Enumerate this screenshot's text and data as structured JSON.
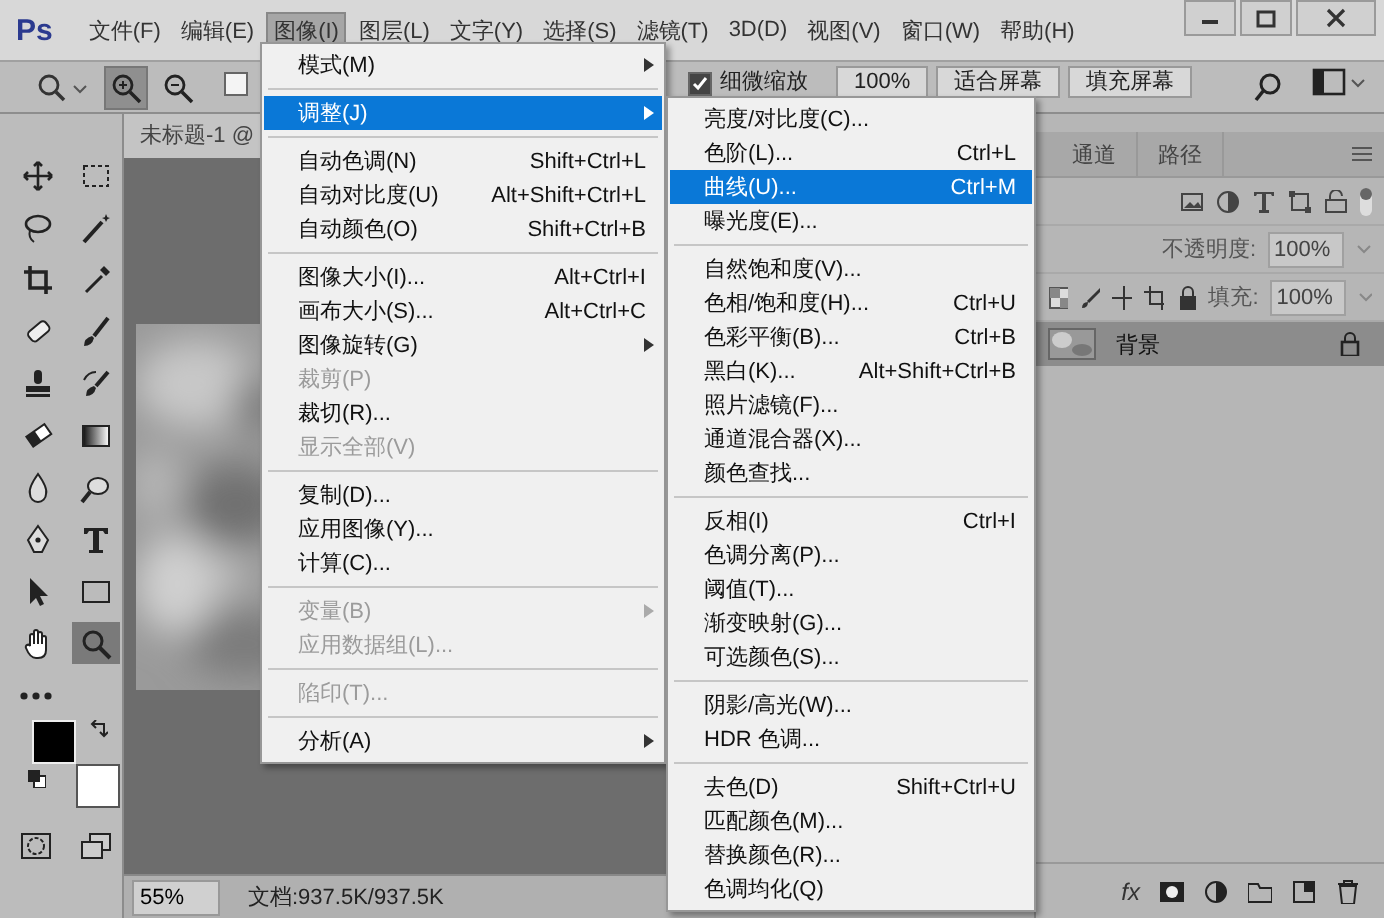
{
  "menubar": {
    "logo": "Ps",
    "items": [
      {
        "label": "文件(F)",
        "selected": false
      },
      {
        "label": "编辑(E)",
        "selected": false
      },
      {
        "label": "图像(I)",
        "selected": true
      },
      {
        "label": "图层(L)",
        "selected": false
      },
      {
        "label": "文字(Y)",
        "selected": false
      },
      {
        "label": "选择(S)",
        "selected": false
      },
      {
        "label": "滤镜(T)",
        "selected": false
      },
      {
        "label": "3D(D)",
        "selected": false
      },
      {
        "label": "视图(V)",
        "selected": false
      },
      {
        "label": "窗口(W)",
        "selected": false
      },
      {
        "label": "帮助(H)",
        "selected": false
      }
    ]
  },
  "options_bar": {
    "zoom_modes": [
      {
        "selected": true
      },
      {
        "selected": false
      }
    ],
    "resize_checkbox": {
      "checked": false
    },
    "scrubby_zoom": {
      "label": "细微缩放",
      "checked": true
    },
    "buttons": [
      "100%",
      "适合屏幕",
      "填充屏幕"
    ]
  },
  "toolbox": {
    "tools": [
      {
        "selected": false
      },
      {
        "selected": false
      },
      {
        "selected": false
      },
      {
        "selected": false
      },
      {
        "selected": false
      },
      {
        "selected": false
      },
      {
        "selected": false
      },
      {
        "selected": false
      },
      {
        "selected": false
      },
      {
        "selected": false
      },
      {
        "selected": false
      },
      {
        "selected": false
      },
      {
        "selected": false
      },
      {
        "selected": false
      },
      {
        "selected": false
      },
      {
        "selected": false
      },
      {
        "selected": false
      },
      {
        "selected": false
      },
      {
        "selected": false
      },
      {
        "selected": true
      }
    ]
  },
  "document": {
    "tab": "未标题-1 @",
    "zoom": "55%",
    "info": "文档:937.5K/937.5K"
  },
  "layers_panel": {
    "tabs": [
      {
        "label": "通道",
        "selected": false
      },
      {
        "label": "路径",
        "selected": false
      }
    ],
    "opacity_label": "不透明度:",
    "opacity": "100%",
    "fill_label": "填充:",
    "fill": "100%",
    "layers": [
      {
        "name": "背景",
        "selected": true,
        "locked": true
      }
    ],
    "footer_text": "fx"
  },
  "image_menu": {
    "groups": [
      [
        {
          "label": "模式(M)",
          "submenu": true,
          "disabled": false,
          "selected": false
        }
      ],
      [
        {
          "label": "调整(J)",
          "submenu": true,
          "disabled": false,
          "selected": true
        }
      ],
      [
        {
          "label": "自动色调(N)",
          "shortcut": "Shift+Ctrl+L",
          "submenu": false,
          "disabled": false,
          "selected": false
        },
        {
          "label": "自动对比度(U)",
          "shortcut": "Alt+Shift+Ctrl+L",
          "submenu": false,
          "disabled": false,
          "selected": false
        },
        {
          "label": "自动颜色(O)",
          "shortcut": "Shift+Ctrl+B",
          "submenu": false,
          "disabled": false,
          "selected": false
        }
      ],
      [
        {
          "label": "图像大小(I)...",
          "shortcut": "Alt+Ctrl+I",
          "submenu": false,
          "disabled": false,
          "selected": false
        },
        {
          "label": "画布大小(S)...",
          "shortcut": "Alt+Ctrl+C",
          "submenu": false,
          "disabled": false,
          "selected": false
        },
        {
          "label": "图像旋转(G)",
          "submenu": true,
          "disabled": false,
          "selected": false
        },
        {
          "label": "裁剪(P)",
          "submenu": false,
          "disabled": true,
          "selected": false
        },
        {
          "label": "裁切(R)...",
          "submenu": false,
          "disabled": false,
          "selected": false
        },
        {
          "label": "显示全部(V)",
          "submenu": false,
          "disabled": true,
          "selected": false
        }
      ],
      [
        {
          "label": "复制(D)...",
          "submenu": false,
          "disabled": false,
          "selected": false
        },
        {
          "label": "应用图像(Y)...",
          "submenu": false,
          "disabled": false,
          "selected": false
        },
        {
          "label": "计算(C)...",
          "submenu": false,
          "disabled": false,
          "selected": false
        }
      ],
      [
        {
          "label": "变量(B)",
          "submenu": true,
          "disabled": true,
          "selected": false
        },
        {
          "label": "应用数据组(L)...",
          "submenu": false,
          "disabled": true,
          "selected": false
        }
      ],
      [
        {
          "label": "陷印(T)...",
          "submenu": false,
          "disabled": true,
          "selected": false
        }
      ],
      [
        {
          "label": "分析(A)",
          "submenu": true,
          "disabled": false,
          "selected": false
        }
      ]
    ]
  },
  "adjust_submenu": {
    "groups": [
      [
        {
          "label": "亮度/对比度(C)...",
          "disabled": false,
          "selected": false
        },
        {
          "label": "色阶(L)...",
          "shortcut": "Ctrl+L",
          "disabled": false,
          "selected": false
        },
        {
          "label": "曲线(U)...",
          "shortcut": "Ctrl+M",
          "disabled": false,
          "selected": true
        },
        {
          "label": "曝光度(E)...",
          "disabled": false,
          "selected": false
        }
      ],
      [
        {
          "label": "自然饱和度(V)...",
          "disabled": false,
          "selected": false
        },
        {
          "label": "色相/饱和度(H)...",
          "shortcut": "Ctrl+U",
          "disabled": false,
          "selected": false
        },
        {
          "label": "色彩平衡(B)...",
          "shortcut": "Ctrl+B",
          "disabled": false,
          "selected": false
        },
        {
          "label": "黑白(K)...",
          "shortcut": "Alt+Shift+Ctrl+B",
          "disabled": false,
          "selected": false
        },
        {
          "label": "照片滤镜(F)...",
          "disabled": false,
          "selected": false
        },
        {
          "label": "通道混合器(X)...",
          "disabled": false,
          "selected": false
        },
        {
          "label": "颜色查找...",
          "disabled": false,
          "selected": false
        }
      ],
      [
        {
          "label": "反相(I)",
          "shortcut": "Ctrl+I",
          "disabled": false,
          "selected": false
        },
        {
          "label": "色调分离(P)...",
          "disabled": false,
          "selected": false
        },
        {
          "label": "阈值(T)...",
          "disabled": false,
          "selected": false
        },
        {
          "label": "渐变映射(G)...",
          "disabled": false,
          "selected": false
        },
        {
          "label": "可选颜色(S)...",
          "disabled": false,
          "selected": false
        }
      ],
      [
        {
          "label": "阴影/高光(W)...",
          "disabled": false,
          "selected": false
        },
        {
          "label": "HDR 色调...",
          "disabled": false,
          "selected": false
        }
      ],
      [
        {
          "label": "去色(D)",
          "shortcut": "Shift+Ctrl+U",
          "disabled": false,
          "selected": false
        },
        {
          "label": "匹配颜色(M)...",
          "disabled": false,
          "selected": false
        },
        {
          "label": "替换颜色(R)...",
          "disabled": false,
          "selected": false
        },
        {
          "label": "色调均化(Q)",
          "disabled": false,
          "selected": false
        }
      ]
    ]
  }
}
